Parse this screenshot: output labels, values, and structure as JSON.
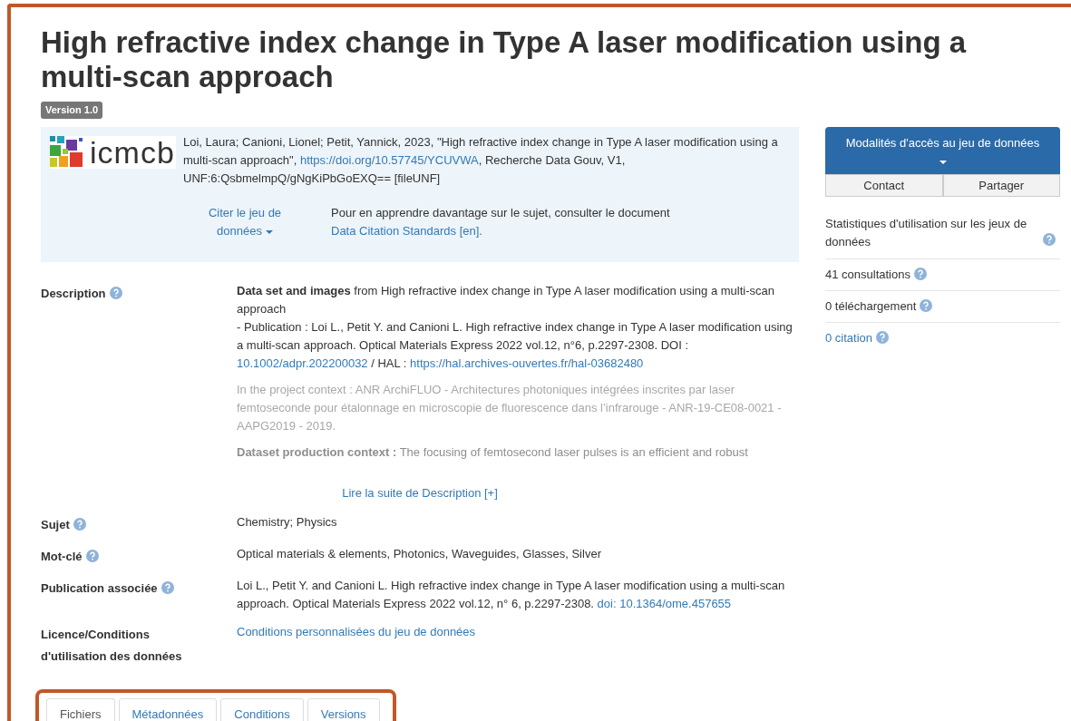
{
  "title": "High refractive index change in Type A laser modification using a multi-scan approach",
  "version_badge": "Version 1.0",
  "citation": {
    "logo_text": "icmcb",
    "segments": [
      {
        "kind": "text",
        "text": "Loi, Laura; Canioni, Lionel; Petit, Yannick, 2023, \"High refractive index change in Type A laser modification using a multi-scan approach\", "
      },
      {
        "kind": "link",
        "text": "https://doi.org/10.57745/YCUVWA"
      },
      {
        "kind": "text",
        "text": ", Recherche Data Gouv, V1, UNF:6:QsbmelmpQ/gNgKiPbGoEXQ== [fileUNF]"
      }
    ],
    "cite_button": "Citer le jeu de données",
    "learn_more": "Pour en apprendre davantage sur le sujet, consulter le document",
    "standards_link": "Data Citation Standards [en]."
  },
  "sidebar": {
    "access_button": "Modalités d'accès au jeu de données",
    "buttons": [
      "Contact",
      "Partager"
    ],
    "stats_title": "Statistiques d'utilisation sur les jeux de données",
    "stats": [
      {
        "kind": "text",
        "label": "41 consultations"
      },
      {
        "kind": "text",
        "label": "0 téléchargement"
      },
      {
        "kind": "link",
        "label": "0 citation"
      }
    ]
  },
  "metadata": [
    {
      "label": "Description",
      "help": true,
      "paragraphs": [
        {
          "kind": "normal",
          "segments": [
            {
              "kind": "text",
              "text": "**Data set and images** from High refractive index change in Type A laser modification using a multi-scan approach"
            },
            {
              "kind": "break"
            },
            {
              "kind": "text",
              "text": "- Publication : Loi L., Petit Y. and Canioni L. High refractive index change in Type A laser modification using a multi-scan approach. Optical Materials Express 2022 vol.12, n°6, p.2297-2308. DOI : "
            },
            {
              "kind": "link",
              "text": "10.1002/adpr.202200032"
            },
            {
              "kind": "text",
              "text": " / HAL : "
            },
            {
              "kind": "link",
              "text": "https://hal.archives-ouvertes.fr/hal-03682480"
            }
          ]
        },
        {
          "kind": "faded",
          "segments": [
            {
              "kind": "text",
              "text": "In the project context : ANR ArchiFLUO - Architectures photoniques intégrées inscrites par laser femtoseconde pour étalonnage en microscopie de fluorescence dans l’infrarouge - ANR-19-CE08-0021 - AAPG2019 - 2019."
            }
          ]
        },
        {
          "kind": "fading",
          "segments": [
            {
              "kind": "text",
              "text": "**Dataset production context :** The focusing of femtosecond laser pulses is an efficient and robust"
            }
          ]
        }
      ],
      "more_link": "Lire la suite de Description [+]"
    },
    {
      "label": "Sujet",
      "help": true,
      "paragraphs": [
        {
          "kind": "normal",
          "segments": [
            {
              "kind": "text",
              "text": "Chemistry; Physics"
            }
          ]
        }
      ]
    },
    {
      "label": "Mot-clé",
      "help": true,
      "paragraphs": [
        {
          "kind": "normal",
          "segments": [
            {
              "kind": "text",
              "text": "Optical materials & elements, Photonics, Waveguides, Glasses, Silver"
            }
          ]
        }
      ]
    },
    {
      "label": "Publication associée",
      "help": true,
      "paragraphs": [
        {
          "kind": "normal",
          "segments": [
            {
              "kind": "text",
              "text": "Loi L., Petit Y. and Canioni L. High refractive index change in Type A laser modification using a multi-scan approach. Optical Materials Express 2022 vol.12, n° 6, p.2297-2308. "
            },
            {
              "kind": "link",
              "text": "doi: 10.1364/ome.457655"
            }
          ]
        }
      ]
    },
    {
      "label": "Licence/Conditions d'utilisation des données",
      "help": false,
      "paragraphs": [
        {
          "kind": "normal",
          "segments": [
            {
              "kind": "link",
              "text": "Conditions personnalisées du jeu de données"
            }
          ]
        }
      ]
    }
  ],
  "tabs": [
    {
      "label": "Fichiers",
      "selected": true
    },
    {
      "label": "Métadonnées",
      "selected": false
    },
    {
      "label": "Conditions",
      "selected": false
    },
    {
      "label": "Versions",
      "selected": false
    }
  ]
}
